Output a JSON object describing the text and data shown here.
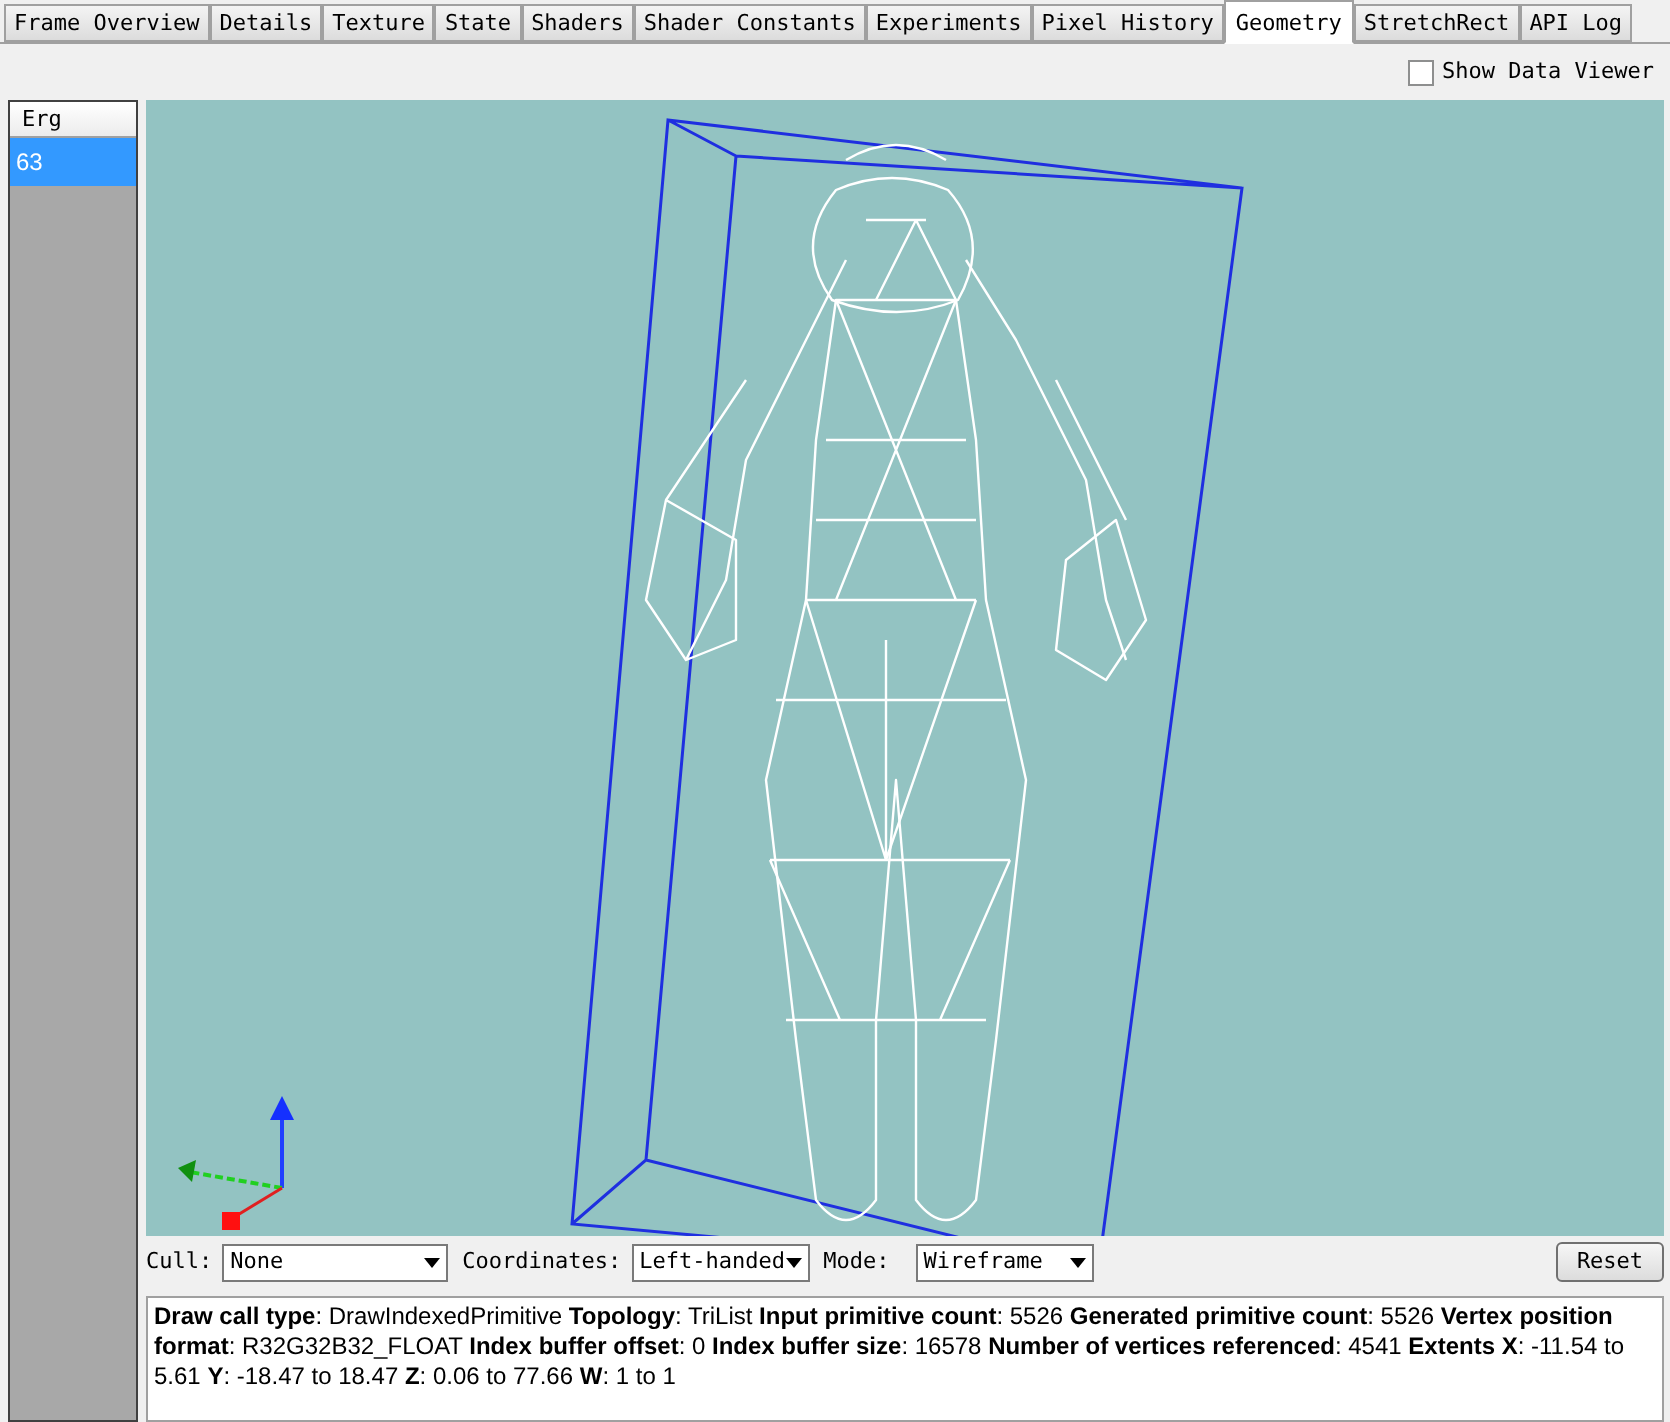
{
  "tabs": [
    {
      "label": "Frame Overview",
      "selected": false
    },
    {
      "label": "Details",
      "selected": false
    },
    {
      "label": "Texture",
      "selected": false
    },
    {
      "label": "State",
      "selected": false
    },
    {
      "label": "Shaders",
      "selected": false
    },
    {
      "label": "Shader Constants",
      "selected": false
    },
    {
      "label": "Experiments",
      "selected": false
    },
    {
      "label": "Pixel History",
      "selected": false
    },
    {
      "label": "Geometry",
      "selected": true
    },
    {
      "label": "StretchRect",
      "selected": false
    },
    {
      "label": "API Log",
      "selected": false
    }
  ],
  "data_viewer_toggle": {
    "label": "Show Data Viewer",
    "checked": false
  },
  "list": {
    "header": "Erg",
    "items": [
      {
        "text": "63",
        "selected": true
      }
    ]
  },
  "controls": {
    "cull": {
      "label": "Cull:",
      "value": "None"
    },
    "coordinates": {
      "label": "Coordinates:",
      "value": "Left-handed"
    },
    "mode": {
      "label": "Mode:",
      "value": "Wireframe"
    },
    "reset_button": "Reset"
  },
  "info": "**Draw call type**: DrawIndexedPrimitive  **Topology**: TriList  **Input primitive count**: 5526  **Generated primitive count**: 5526  **Vertex position format**: R32G32B32_FLOAT  **Index buffer offset**: 0  **Index buffer size**: 16578  **Number of vertices referenced**: 4541 **Extents X**: -11.54 to 5.61 **Y**: -18.47 to 18.47 **Z**: 0.06 to 77.66 **W**: 1 to 1"
}
